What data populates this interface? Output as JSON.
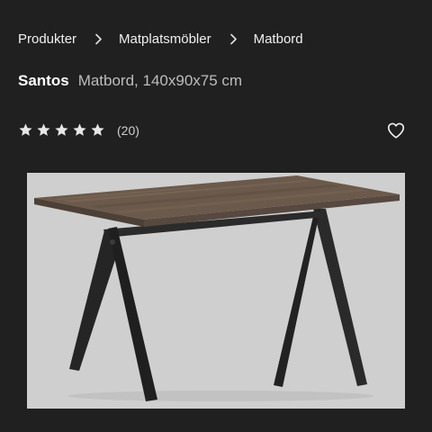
{
  "breadcrumb": {
    "items": [
      "Produkter",
      "Matplatsmöbler",
      "Matbord"
    ]
  },
  "product": {
    "name": "Santos",
    "description": "Matbord, 140x90x75 cm",
    "rating": 5,
    "review_count": "(20)"
  },
  "icons": {
    "separator": "chevron-right-icon",
    "star": "star-icon",
    "favorite": "heart-outline-icon"
  },
  "colors": {
    "background": "#202020",
    "text": "#f2f2f2",
    "muted": "#bdbdbd",
    "star": "#e6e6e6",
    "image_bg": "#cfcfcf"
  }
}
